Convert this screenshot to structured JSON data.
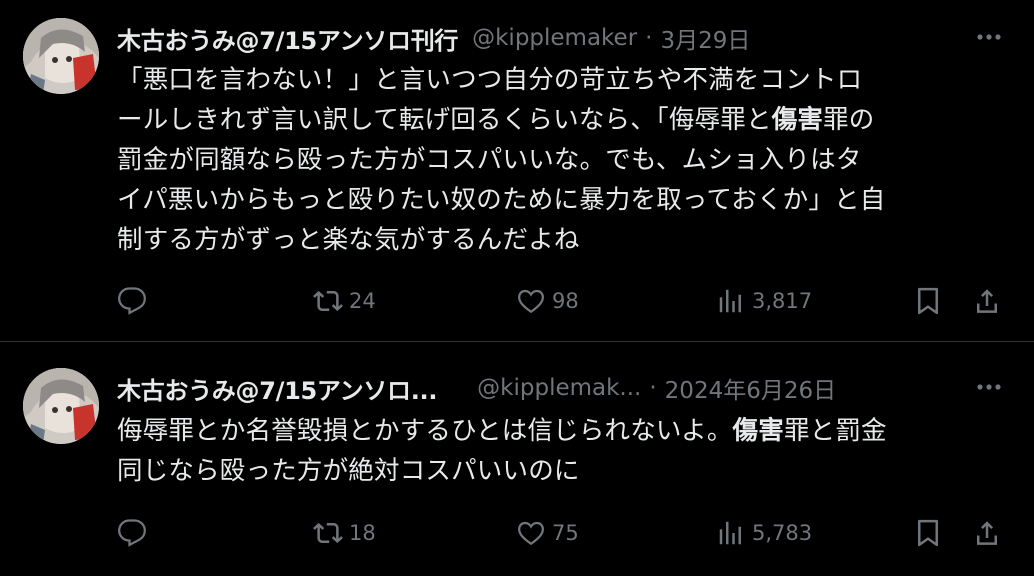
{
  "tweets": [
    {
      "name": "木古おうみ@7/15アンソロ刊行",
      "handle": "@kipplemaker",
      "sep": "·",
      "date": "3月29日",
      "lines": [
        [
          {
            "t": "「悪口を言わない！」と言いつつ自分の苛立ちや不満をコントロ"
          }
        ],
        [
          {
            "t": "ールしきれず言い訳して転げ回るくらいなら、「侮辱罪と"
          },
          {
            "t": "傷害",
            "b": true
          },
          {
            "t": "罪の"
          }
        ],
        [
          {
            "t": "罰金が同額なら殴った方がコスパいいな。でも、ムショ入りはタ"
          }
        ],
        [
          {
            "t": "イパ悪いからもっと殴りたい奴のために暴力を取っておくか」と自"
          }
        ],
        [
          {
            "t": "制する方がずっと楽な気がするんだよね"
          }
        ]
      ],
      "retweets": "24",
      "likes": "98",
      "views": "3,817"
    },
    {
      "name": "木古おうみ@7/15アンソロ...",
      "handle": "@kipplemak...",
      "sep": "·",
      "date": "2024年6月26日",
      "lines": [
        [
          {
            "t": "侮辱罪とか名誉毀損とかするひとは信じられないよ。"
          },
          {
            "t": "傷害",
            "b": true
          },
          {
            "t": "罪と罰金"
          }
        ],
        [
          {
            "t": "同じなら殴った方が絶対コスパいいのに"
          }
        ]
      ],
      "retweets": "18",
      "likes": "75",
      "views": "5,783"
    }
  ],
  "icons": {
    "more": "more-icon",
    "reply": "reply-icon",
    "retweet": "retweet-icon",
    "like": "like-icon",
    "views": "views-icon",
    "bookmark": "bookmark-icon",
    "share": "share-icon"
  },
  "colors": {
    "background": "#000000",
    "text": "#e7e9ea",
    "muted": "#71767b",
    "divider": "#2f3336"
  }
}
